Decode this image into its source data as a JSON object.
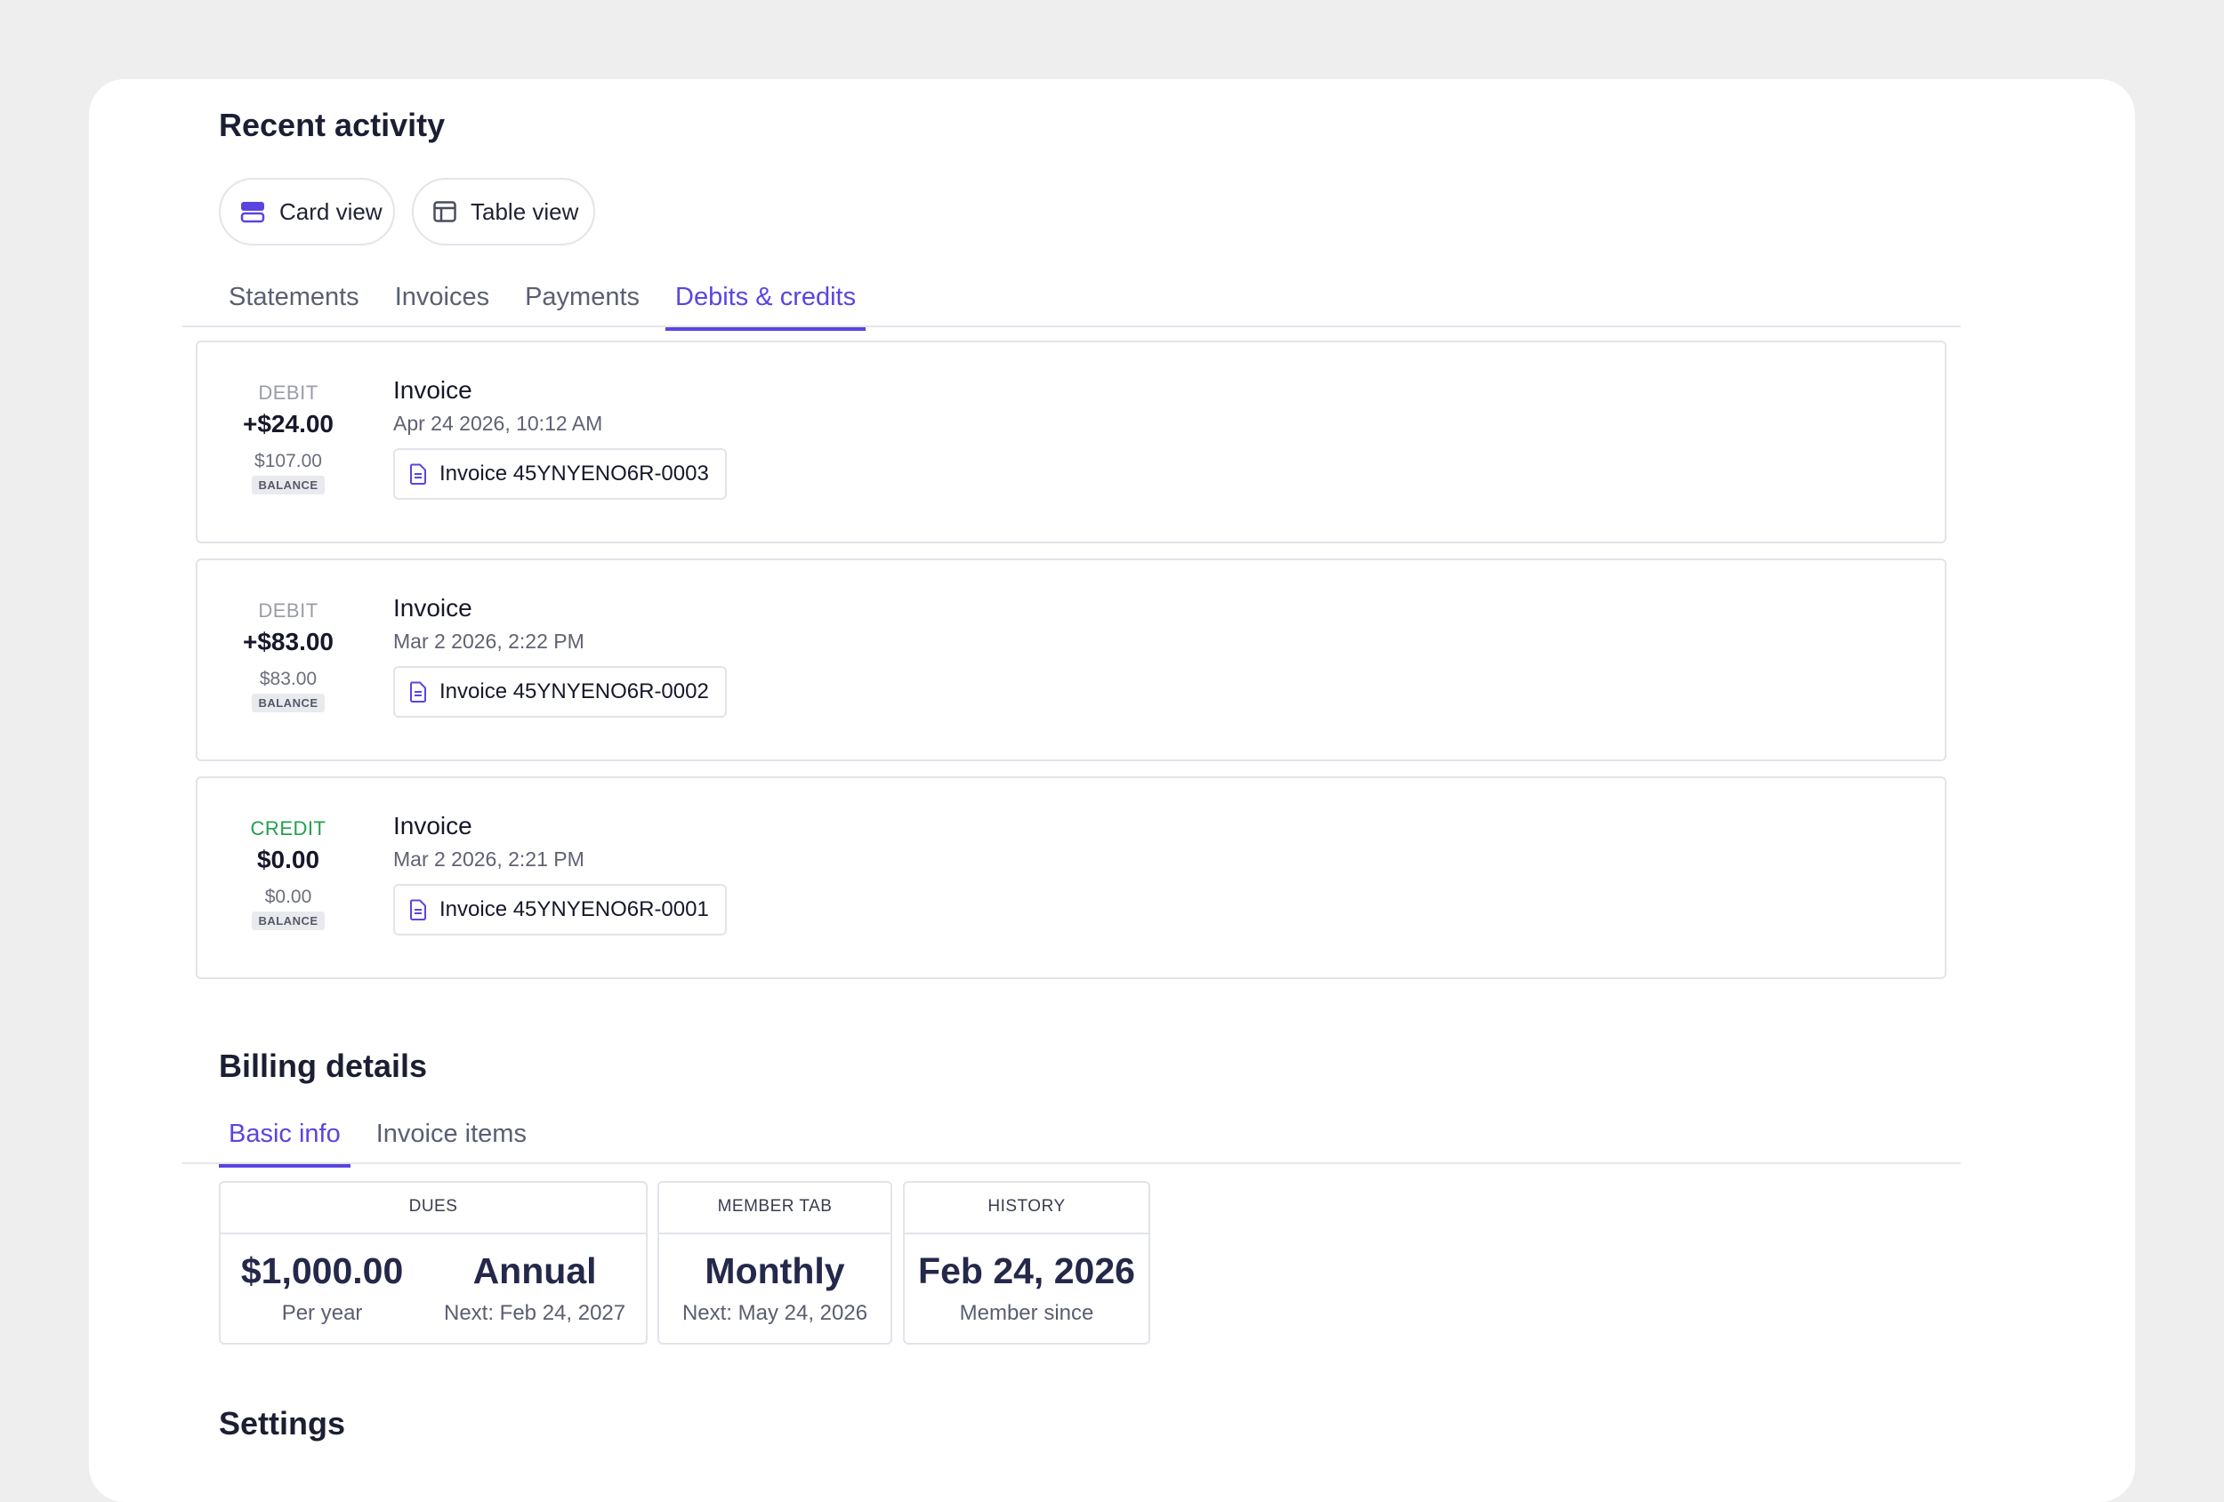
{
  "recent_activity": {
    "title": "Recent activity",
    "view_buttons": [
      {
        "label": "Card view",
        "icon": "card-view-icon"
      },
      {
        "label": "Table view",
        "icon": "table-view-icon"
      }
    ],
    "tabs": [
      "Statements",
      "Invoices",
      "Payments",
      "Debits & credits"
    ],
    "active_tab": "Debits & credits",
    "entries": [
      {
        "kind": "DEBIT",
        "amount": "+$24.00",
        "balance": "$107.00",
        "balance_tag": "BALANCE",
        "title": "Invoice",
        "date": "Apr 24 2026, 10:12 AM",
        "invoice_label": "Invoice 45YNYENO6R-0003"
      },
      {
        "kind": "DEBIT",
        "amount": "+$83.00",
        "balance": "$83.00",
        "balance_tag": "BALANCE",
        "title": "Invoice",
        "date": "Mar 2 2026, 2:22 PM",
        "invoice_label": "Invoice 45YNYENO6R-0002"
      },
      {
        "kind": "CREDIT",
        "amount": "$0.00",
        "balance": "$0.00",
        "balance_tag": "BALANCE",
        "title": "Invoice",
        "date": "Mar 2 2026, 2:21 PM",
        "invoice_label": "Invoice 45YNYENO6R-0001"
      }
    ]
  },
  "billing": {
    "title": "Billing details",
    "tabs": [
      "Basic info",
      "Invoice items"
    ],
    "active_tab": "Basic info",
    "cards": {
      "dues": {
        "header": "DUES",
        "amount": "$1,000.00",
        "amount_sub": "Per year",
        "period": "Annual",
        "period_sub": "Next: Feb 24, 2027"
      },
      "member_tab": {
        "header": "MEMBER TAB",
        "value": "Monthly",
        "sub": "Next: May 24, 2026"
      },
      "history": {
        "header": "HISTORY",
        "value": "Feb 24, 2026",
        "sub": "Member since"
      }
    }
  },
  "settings": {
    "title": "Settings"
  },
  "colors": {
    "accent": "#5a45e0",
    "credit": "#22a04b",
    "background": "#eeeeee"
  }
}
